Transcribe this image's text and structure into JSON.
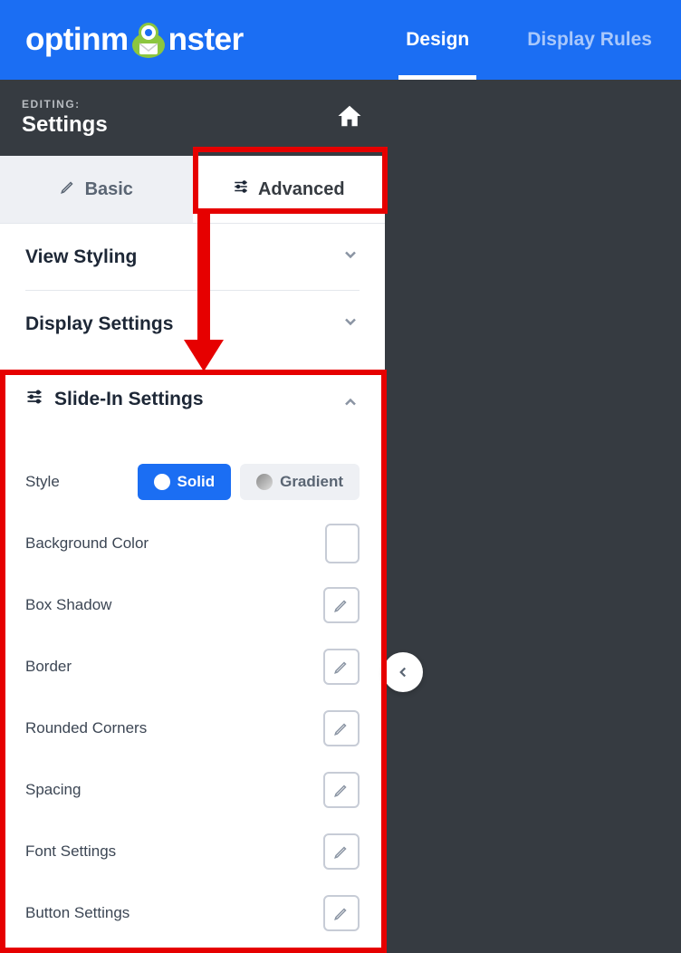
{
  "header": {
    "logo_pre": "optinm",
    "logo_post": "nster",
    "nav": {
      "design": "Design",
      "display_rules": "Display Rules"
    }
  },
  "editing": {
    "label": "EDITING:",
    "title": "Settings"
  },
  "tabs": {
    "basic": "Basic",
    "advanced": "Advanced"
  },
  "sections": {
    "view_styling": "View Styling",
    "display_settings": "Display Settings",
    "slide_in": "Slide-In Settings"
  },
  "slide_in": {
    "style_label": "Style",
    "solid": "Solid",
    "gradient": "Gradient",
    "background_color": "Background Color",
    "box_shadow": "Box Shadow",
    "border": "Border",
    "rounded_corners": "Rounded Corners",
    "spacing": "Spacing",
    "font_settings": "Font Settings",
    "button_settings": "Button Settings"
  }
}
